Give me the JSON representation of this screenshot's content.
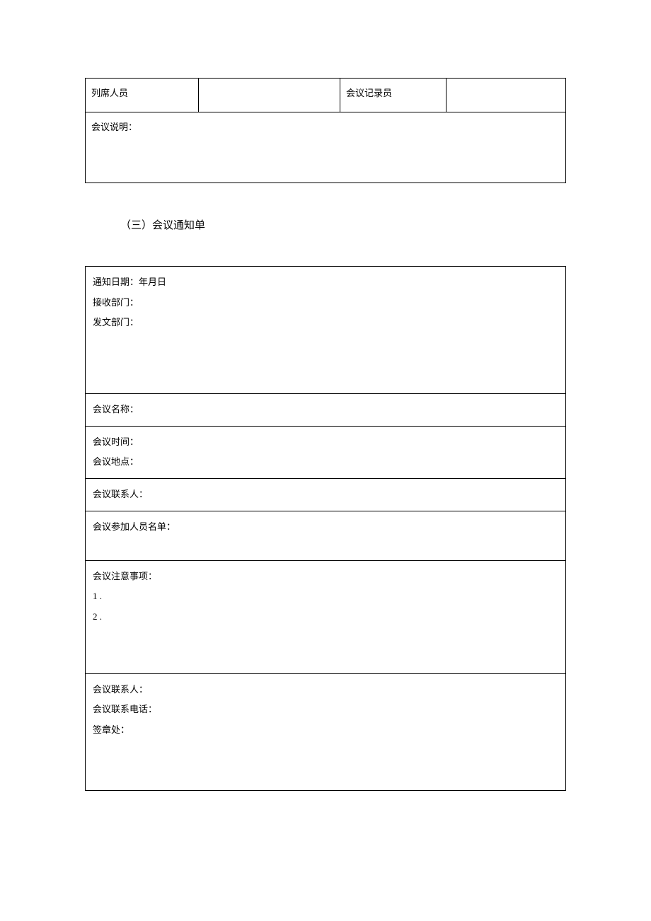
{
  "top_table": {
    "attendees_label": "列席人员",
    "attendees_value": "",
    "recorder_label": "会议记录员",
    "recorder_value": "",
    "meeting_notes_label": "会议说明："
  },
  "section_heading": "（三）会议通知单",
  "notice_form": {
    "header": {
      "notice_date_label": "通知日期：年月日",
      "receiving_dept_label": "接收部门：",
      "sending_dept_label": "发文部门："
    },
    "meeting_name_label": "会议名称：",
    "time_location": {
      "time_label": "会议时间：",
      "location_label": "会议地点："
    },
    "contact_label": "会议联系人：",
    "attendees_list_label": "会议参加人员名单：",
    "notes": {
      "header_label": "会议注意事项：",
      "item1": "1 .",
      "item2": "2 ."
    },
    "footer": {
      "contact_person_label": "会议联系人：",
      "contact_phone_label": "会议联系电话：",
      "signature_label": "签章处："
    }
  }
}
